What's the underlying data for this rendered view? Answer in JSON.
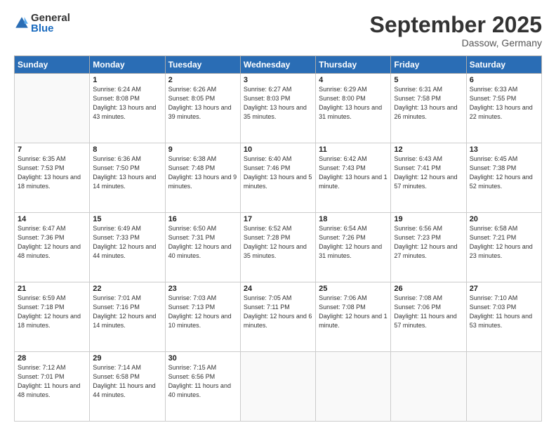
{
  "header": {
    "logo_general": "General",
    "logo_blue": "Blue",
    "month": "September 2025",
    "location": "Dassow, Germany"
  },
  "weekdays": [
    "Sunday",
    "Monday",
    "Tuesday",
    "Wednesday",
    "Thursday",
    "Friday",
    "Saturday"
  ],
  "weeks": [
    [
      {
        "day": "",
        "sunrise": "",
        "sunset": "",
        "daylight": ""
      },
      {
        "day": "1",
        "sunrise": "Sunrise: 6:24 AM",
        "sunset": "Sunset: 8:08 PM",
        "daylight": "Daylight: 13 hours and 43 minutes."
      },
      {
        "day": "2",
        "sunrise": "Sunrise: 6:26 AM",
        "sunset": "Sunset: 8:05 PM",
        "daylight": "Daylight: 13 hours and 39 minutes."
      },
      {
        "day": "3",
        "sunrise": "Sunrise: 6:27 AM",
        "sunset": "Sunset: 8:03 PM",
        "daylight": "Daylight: 13 hours and 35 minutes."
      },
      {
        "day": "4",
        "sunrise": "Sunrise: 6:29 AM",
        "sunset": "Sunset: 8:00 PM",
        "daylight": "Daylight: 13 hours and 31 minutes."
      },
      {
        "day": "5",
        "sunrise": "Sunrise: 6:31 AM",
        "sunset": "Sunset: 7:58 PM",
        "daylight": "Daylight: 13 hours and 26 minutes."
      },
      {
        "day": "6",
        "sunrise": "Sunrise: 6:33 AM",
        "sunset": "Sunset: 7:55 PM",
        "daylight": "Daylight: 13 hours and 22 minutes."
      }
    ],
    [
      {
        "day": "7",
        "sunrise": "Sunrise: 6:35 AM",
        "sunset": "Sunset: 7:53 PM",
        "daylight": "Daylight: 13 hours and 18 minutes."
      },
      {
        "day": "8",
        "sunrise": "Sunrise: 6:36 AM",
        "sunset": "Sunset: 7:50 PM",
        "daylight": "Daylight: 13 hours and 14 minutes."
      },
      {
        "day": "9",
        "sunrise": "Sunrise: 6:38 AM",
        "sunset": "Sunset: 7:48 PM",
        "daylight": "Daylight: 13 hours and 9 minutes."
      },
      {
        "day": "10",
        "sunrise": "Sunrise: 6:40 AM",
        "sunset": "Sunset: 7:46 PM",
        "daylight": "Daylight: 13 hours and 5 minutes."
      },
      {
        "day": "11",
        "sunrise": "Sunrise: 6:42 AM",
        "sunset": "Sunset: 7:43 PM",
        "daylight": "Daylight: 13 hours and 1 minute."
      },
      {
        "day": "12",
        "sunrise": "Sunrise: 6:43 AM",
        "sunset": "Sunset: 7:41 PM",
        "daylight": "Daylight: 12 hours and 57 minutes."
      },
      {
        "day": "13",
        "sunrise": "Sunrise: 6:45 AM",
        "sunset": "Sunset: 7:38 PM",
        "daylight": "Daylight: 12 hours and 52 minutes."
      }
    ],
    [
      {
        "day": "14",
        "sunrise": "Sunrise: 6:47 AM",
        "sunset": "Sunset: 7:36 PM",
        "daylight": "Daylight: 12 hours and 48 minutes."
      },
      {
        "day": "15",
        "sunrise": "Sunrise: 6:49 AM",
        "sunset": "Sunset: 7:33 PM",
        "daylight": "Daylight: 12 hours and 44 minutes."
      },
      {
        "day": "16",
        "sunrise": "Sunrise: 6:50 AM",
        "sunset": "Sunset: 7:31 PM",
        "daylight": "Daylight: 12 hours and 40 minutes."
      },
      {
        "day": "17",
        "sunrise": "Sunrise: 6:52 AM",
        "sunset": "Sunset: 7:28 PM",
        "daylight": "Daylight: 12 hours and 35 minutes."
      },
      {
        "day": "18",
        "sunrise": "Sunrise: 6:54 AM",
        "sunset": "Sunset: 7:26 PM",
        "daylight": "Daylight: 12 hours and 31 minutes."
      },
      {
        "day": "19",
        "sunrise": "Sunrise: 6:56 AM",
        "sunset": "Sunset: 7:23 PM",
        "daylight": "Daylight: 12 hours and 27 minutes."
      },
      {
        "day": "20",
        "sunrise": "Sunrise: 6:58 AM",
        "sunset": "Sunset: 7:21 PM",
        "daylight": "Daylight: 12 hours and 23 minutes."
      }
    ],
    [
      {
        "day": "21",
        "sunrise": "Sunrise: 6:59 AM",
        "sunset": "Sunset: 7:18 PM",
        "daylight": "Daylight: 12 hours and 18 minutes."
      },
      {
        "day": "22",
        "sunrise": "Sunrise: 7:01 AM",
        "sunset": "Sunset: 7:16 PM",
        "daylight": "Daylight: 12 hours and 14 minutes."
      },
      {
        "day": "23",
        "sunrise": "Sunrise: 7:03 AM",
        "sunset": "Sunset: 7:13 PM",
        "daylight": "Daylight: 12 hours and 10 minutes."
      },
      {
        "day": "24",
        "sunrise": "Sunrise: 7:05 AM",
        "sunset": "Sunset: 7:11 PM",
        "daylight": "Daylight: 12 hours and 6 minutes."
      },
      {
        "day": "25",
        "sunrise": "Sunrise: 7:06 AM",
        "sunset": "Sunset: 7:08 PM",
        "daylight": "Daylight: 12 hours and 1 minute."
      },
      {
        "day": "26",
        "sunrise": "Sunrise: 7:08 AM",
        "sunset": "Sunset: 7:06 PM",
        "daylight": "Daylight: 11 hours and 57 minutes."
      },
      {
        "day": "27",
        "sunrise": "Sunrise: 7:10 AM",
        "sunset": "Sunset: 7:03 PM",
        "daylight": "Daylight: 11 hours and 53 minutes."
      }
    ],
    [
      {
        "day": "28",
        "sunrise": "Sunrise: 7:12 AM",
        "sunset": "Sunset: 7:01 PM",
        "daylight": "Daylight: 11 hours and 48 minutes."
      },
      {
        "day": "29",
        "sunrise": "Sunrise: 7:14 AM",
        "sunset": "Sunset: 6:58 PM",
        "daylight": "Daylight: 11 hours and 44 minutes."
      },
      {
        "day": "30",
        "sunrise": "Sunrise: 7:15 AM",
        "sunset": "Sunset: 6:56 PM",
        "daylight": "Daylight: 11 hours and 40 minutes."
      },
      {
        "day": "",
        "sunrise": "",
        "sunset": "",
        "daylight": ""
      },
      {
        "day": "",
        "sunrise": "",
        "sunset": "",
        "daylight": ""
      },
      {
        "day": "",
        "sunrise": "",
        "sunset": "",
        "daylight": ""
      },
      {
        "day": "",
        "sunrise": "",
        "sunset": "",
        "daylight": ""
      }
    ]
  ]
}
